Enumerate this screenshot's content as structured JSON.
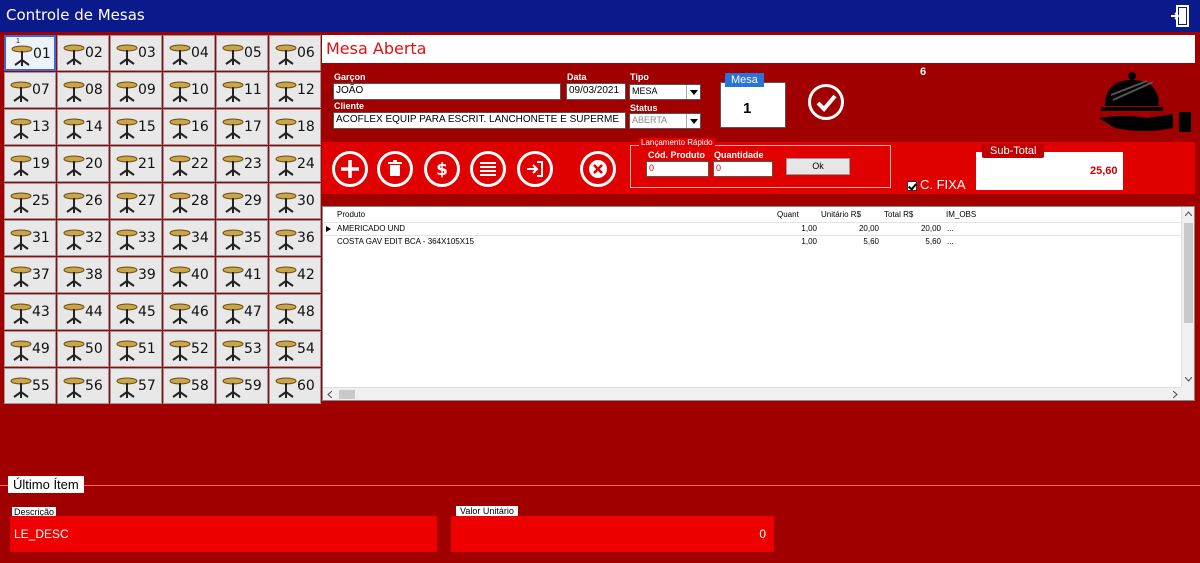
{
  "window": {
    "title": "Controle de Mesas"
  },
  "tables": [
    "01",
    "02",
    "03",
    "04",
    "05",
    "06",
    "07",
    "08",
    "09",
    "10",
    "11",
    "12",
    "13",
    "14",
    "15",
    "16",
    "17",
    "18",
    "19",
    "20",
    "21",
    "22",
    "23",
    "24",
    "25",
    "26",
    "27",
    "28",
    "29",
    "30",
    "31",
    "32",
    "33",
    "34",
    "35",
    "36",
    "37",
    "38",
    "39",
    "40",
    "41",
    "42",
    "43",
    "44",
    "45",
    "46",
    "47",
    "48",
    "49",
    "50",
    "51",
    "52",
    "53",
    "54",
    "55",
    "56",
    "57",
    "58",
    "59",
    "60"
  ],
  "first_table_mark": "1",
  "header": {
    "status_title": "Mesa Aberta",
    "count": "6"
  },
  "form": {
    "garcon_label": "Garçon",
    "garcon_value": "JOÃO",
    "data_label": "Data",
    "data_value": "09/03/2021",
    "tipo_label": "Tipo",
    "tipo_value": "MESA",
    "cliente_label": "Cliente",
    "cliente_value": "ACOFLEX EQUIP PARA ESCRIT. LANCHONETE E SUPERME",
    "status_label": "Status",
    "status_value": "ABERTA",
    "mesa_label": "Mesa",
    "mesa_value": "1"
  },
  "quick": {
    "legend": "Lançamento Rápido",
    "cod_label": "Cód. Produto",
    "cod_value": "0",
    "qtd_label": "Quantidade",
    "qtd_value": "0",
    "ok_label": "Ok"
  },
  "subtotal": {
    "label": "Sub-Total",
    "value": "25,60"
  },
  "fixa": {
    "label": "C. FIXA"
  },
  "grid": {
    "columns": [
      "Produto",
      "Quant",
      "Unitário R$",
      "Total R$",
      "IM_OBS"
    ],
    "rows": [
      {
        "produto": "AMERICADO UND",
        "quant": "1,00",
        "unit": "20,00",
        "total": "20,00",
        "obs": "..."
      },
      {
        "produto": "COSTA GAV EDIT BCA - 364X105X15",
        "quant": "1,00",
        "unit": "5,60",
        "total": "5,60",
        "obs": "..."
      }
    ]
  },
  "last_item": {
    "title": "Último Ítem",
    "desc_label": "Descrição",
    "desc_value": "LE_DESC",
    "valor_label": "Valor Unitário",
    "valor_value": "0"
  },
  "colors": {
    "title_bar": "#0a1a8a",
    "background": "#a00000",
    "accent": "#e00000"
  }
}
